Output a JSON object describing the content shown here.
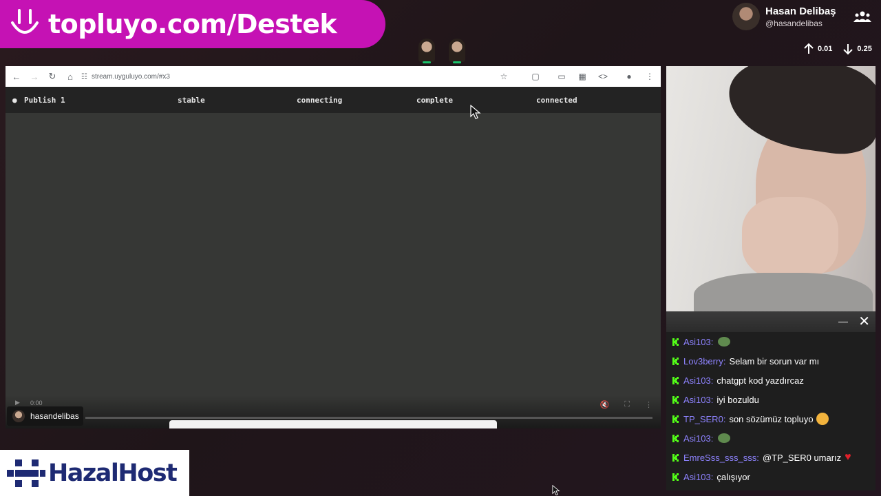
{
  "banner": {
    "text": "topluyo.com/Destek",
    "icon": "smile-icon",
    "color": "#c512b4"
  },
  "profile": {
    "name": "Hasan Delibaş",
    "handle": "@hasandelibas"
  },
  "stats": {
    "up": "0.01",
    "down": "0.25"
  },
  "browser": {
    "url": "stream.uyguluyo.com/#x3",
    "status": {
      "publish": "Publish 1",
      "s1": "stable",
      "s2": "connecting",
      "s3": "complete",
      "s4": "connected"
    },
    "video_time": "0:00"
  },
  "streamer_chip": "hasandelibas",
  "chat": {
    "messages": [
      {
        "user": "Asi103",
        "text": "",
        "emote": "frog"
      },
      {
        "user": "Lov3berry",
        "text": "Selam bir sorun var mı",
        "emote": ""
      },
      {
        "user": "Asi103",
        "text": "chatgpt kod yazdırcaz",
        "emote": ""
      },
      {
        "user": "Asi103",
        "text": "iyi bozuldu",
        "emote": ""
      },
      {
        "user": "TP_SER0",
        "text": "son sözümüz topluyo",
        "emote": "smile"
      },
      {
        "user": "Asi103",
        "text": "",
        "emote": "frog"
      },
      {
        "user": "EmreSss_sss_sss",
        "text": "@TP_SER0 umarız",
        "emote": "heart"
      },
      {
        "user": "Asi103",
        "text": "çalışıyor",
        "emote": ""
      }
    ],
    "username_color": "#8e83ff",
    "badge_color": "#53fc18"
  },
  "sponsor": {
    "text": "HazalHost",
    "color": "#1e2a73"
  }
}
